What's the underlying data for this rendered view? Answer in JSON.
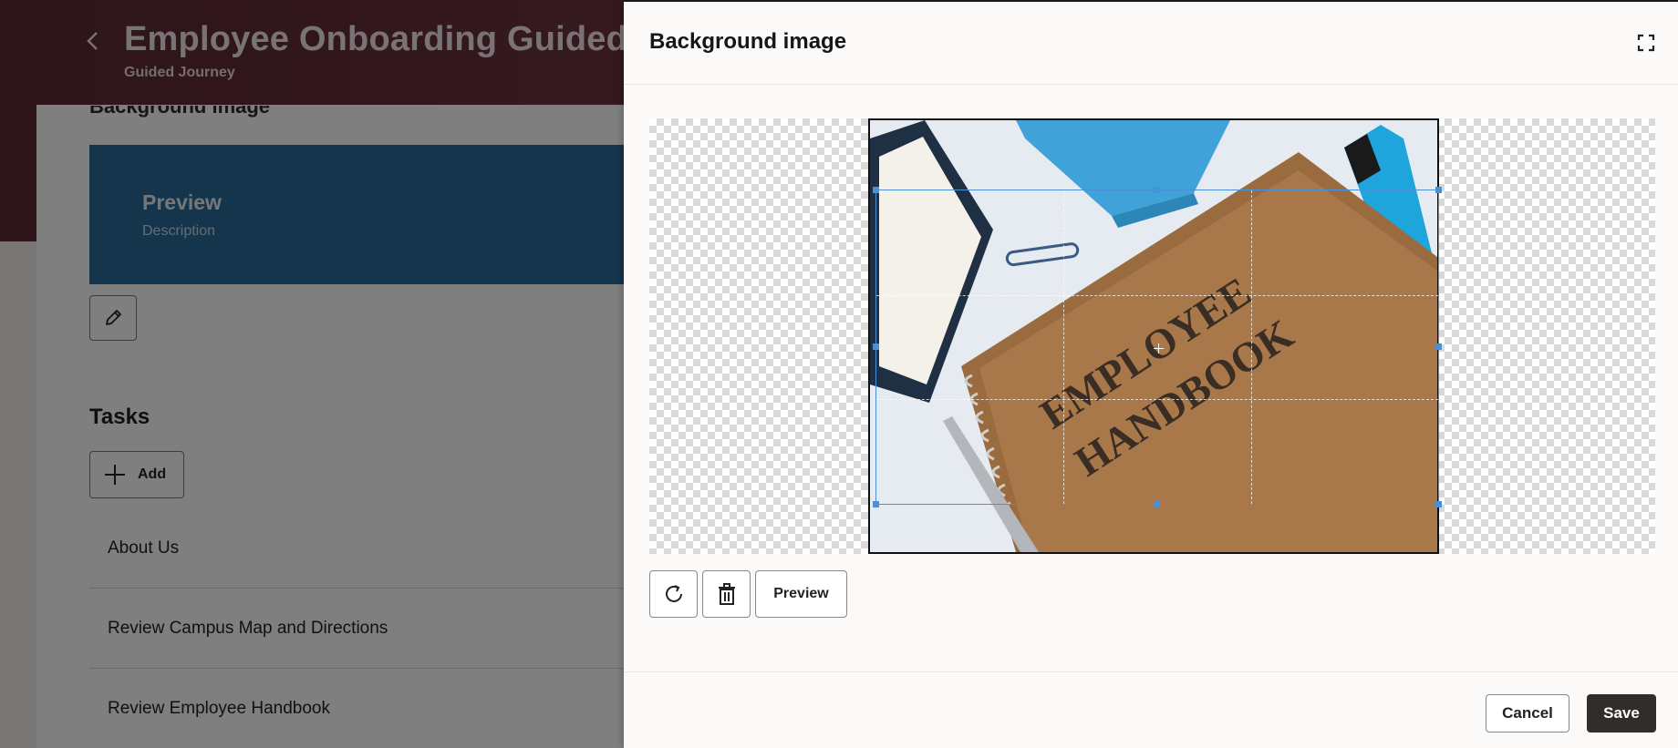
{
  "background_page": {
    "title": "Employee Onboarding Guided Journey",
    "subtitle": "Guided Journey",
    "section_heading": "Background image",
    "preview_card": {
      "title": "Preview",
      "description": "Description"
    },
    "tasks": {
      "heading": "Tasks",
      "add_label": "Add",
      "items": [
        "About Us",
        "Review Campus Map and Directions",
        "Review Employee Handbook"
      ]
    }
  },
  "drawer": {
    "title": "Background image",
    "image": {
      "caption_line1": "EMPLOYEE",
      "caption_line2": "HANDBOOK"
    },
    "toolbar": {
      "preview_label": "Preview"
    },
    "footer": {
      "cancel_label": "Cancel",
      "save_label": "Save"
    }
  },
  "colors": {
    "header": "#6e3540",
    "preview_banner": "#2b6b98",
    "crop_accent": "#4a90d9",
    "save_button": "#312d2a"
  },
  "icons": [
    "back-icon",
    "edit-icon",
    "plus-icon",
    "fullscreen-icon",
    "rotate-icon",
    "trash-icon"
  ]
}
